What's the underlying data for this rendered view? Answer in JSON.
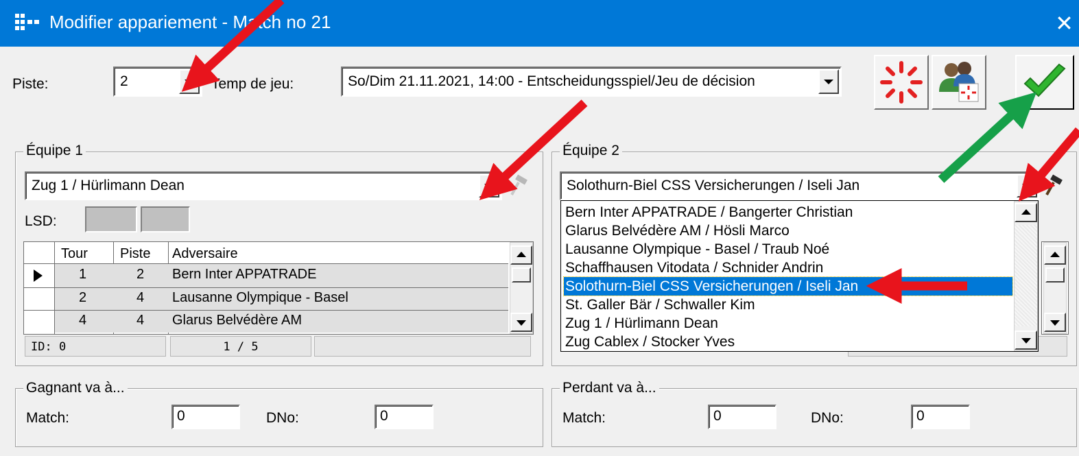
{
  "window": {
    "title": "Modifier appariement - Match no 21",
    "close_glyph": "✕"
  },
  "top": {
    "piste_label": "Piste:",
    "piste_value": "2",
    "temp_label": "Temp de jeu:",
    "temp_value": "So/Dim 21.11.2021, 14:00 - Entscheidungsspiel/Jeu de décision"
  },
  "toolbar": {
    "icons": [
      "spinner-icon",
      "users-refresh-icon",
      "checkmark-icon"
    ]
  },
  "team1": {
    "legend": "Équipe 1",
    "combo_value": "Zug 1 / Hürlimann Dean",
    "lsd_label": "LSD:",
    "grid": {
      "columns": [
        "Tour",
        "Piste",
        "Adversaire"
      ],
      "rows": [
        {
          "tour": "1",
          "piste": "2",
          "adv": "Bern Inter APPATRADE",
          "current": true
        },
        {
          "tour": "2",
          "piste": "4",
          "adv": "Lausanne Olympique - Basel",
          "current": false
        },
        {
          "tour": "4",
          "piste": "4",
          "adv": "Glarus Belvédère AM",
          "current": false
        }
      ],
      "status_id": "ID: 0",
      "status_pos": "1 / 5"
    }
  },
  "team2": {
    "legend": "Équipe 2",
    "combo_value": "Solothurn-Biel CSS Versicherungen / Iseli Jan",
    "dropdown_options": [
      "Bern Inter APPATRADE / Bangerter Christian",
      "Glarus Belvédère AM / Hösli Marco",
      "Lausanne Olympique - Basel / Traub Noé",
      "Schaffhausen Vitodata / Schnider Andrin",
      "Solothurn-Biel CSS Versicherungen / Iseli Jan",
      "St. Galler Bär / Schwaller Kim",
      "Zug 1 / Hürlimann Dean",
      "Zug Cablex / Stocker Yves"
    ],
    "selected_index": 4
  },
  "winner": {
    "legend": "Gagnant va à...",
    "match_label": "Match:",
    "match_value": "0",
    "dno_label": "DNo:",
    "dno_value": "0"
  },
  "loser": {
    "legend": "Perdant va à...",
    "match_label": "Match:",
    "match_value": "0",
    "dno_label": "DNo:",
    "dno_value": "0"
  },
  "colors": {
    "titlebar": "#0078d7",
    "selection": "#0078d7",
    "annotation_red": "#e8141c",
    "annotation_green": "#16a049"
  }
}
